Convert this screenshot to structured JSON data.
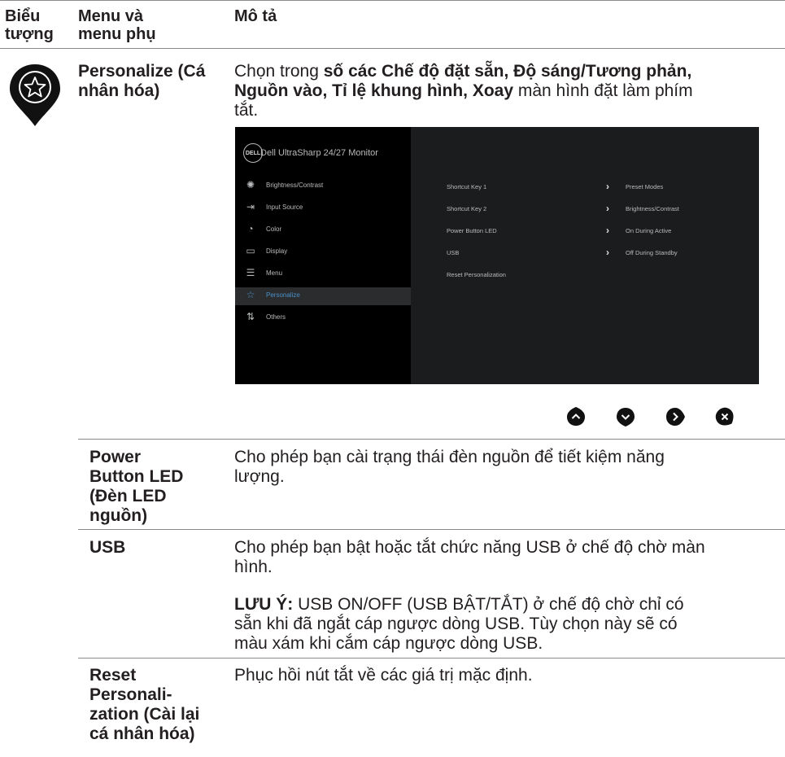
{
  "header": {
    "col_icon": [
      "Biểu",
      "tượng"
    ],
    "col_menu": [
      "Menu và",
      "menu phụ"
    ],
    "col_desc": "Mô tả"
  },
  "row_personalize": {
    "icon": "star-icon",
    "menu": [
      "Personalize (Cá",
      "nhân hóa)"
    ],
    "desc_lines": [
      {
        "a": "Chọn trong ",
        "b": "số các Chế độ đặt sẵn, Độ sáng/Tương phản,"
      },
      {
        "b": "Nguồn vào, Tỉ lệ khung hình, Xoay",
        "a": " màn hình đặt làm phím"
      },
      {
        "a": "tắt."
      }
    ]
  },
  "osd": {
    "brand": "DELL",
    "title": "Dell UltraSharp 24/27 Monitor",
    "menu": [
      {
        "label": "Brightness/Contrast",
        "icon": "brightness-icon",
        "glyph": "✺"
      },
      {
        "label": "Input Source",
        "icon": "input-source-icon",
        "glyph": "⇥"
      },
      {
        "label": "Color",
        "icon": "color-icon",
        "glyph": "◔"
      },
      {
        "label": "Display",
        "icon": "display-icon",
        "glyph": "▭"
      },
      {
        "label": "Menu",
        "icon": "menu-icon",
        "glyph": "☰"
      },
      {
        "label": "Personalize",
        "icon": "star-icon",
        "glyph": "☆"
      },
      {
        "label": "Others",
        "icon": "others-icon",
        "glyph": "⇅"
      }
    ],
    "settings": [
      {
        "key": "Shortcut Key 1",
        "value": "Preset Modes"
      },
      {
        "key": "Shortcut Key 2",
        "value": "Brightness/Contrast"
      },
      {
        "key": "Power Button LED",
        "value": "On During Active"
      },
      {
        "key": "USB",
        "value": "Off During Standby"
      },
      {
        "key": "Reset Personalization",
        "value": ""
      }
    ]
  },
  "nav_buttons": [
    "up-icon",
    "down-icon",
    "right-icon",
    "close-icon"
  ],
  "rows": [
    {
      "menu": [
        "Power",
        "Button LED",
        "(Đèn LED",
        "nguồn)"
      ],
      "desc": [
        "Cho phép bạn cài trạng thái đèn nguồn để tiết kiệm năng",
        "lượng."
      ]
    },
    {
      "menu": [
        "USB"
      ],
      "desc": [
        "Cho phép bạn bật hoặc tắt chức năng USB ở chế độ chờ màn",
        "hình."
      ],
      "note_label": "LƯU Ý:",
      "note": [
        " USB ON/OFF (USB BẬT/TẮT) ở chế độ chờ chỉ có",
        "sẵn khi đã ngắt cáp ngược dòng USB. Tùy chọn này sẽ có",
        "màu xám khi cắm cáp ngược dòng USB."
      ]
    },
    {
      "menu": [
        "Reset",
        "Personali-",
        "zation (Cài lại",
        "cá nhân hóa)"
      ],
      "desc": [
        "Phục hồi nút tắt về các giá trị mặc định."
      ]
    }
  ]
}
